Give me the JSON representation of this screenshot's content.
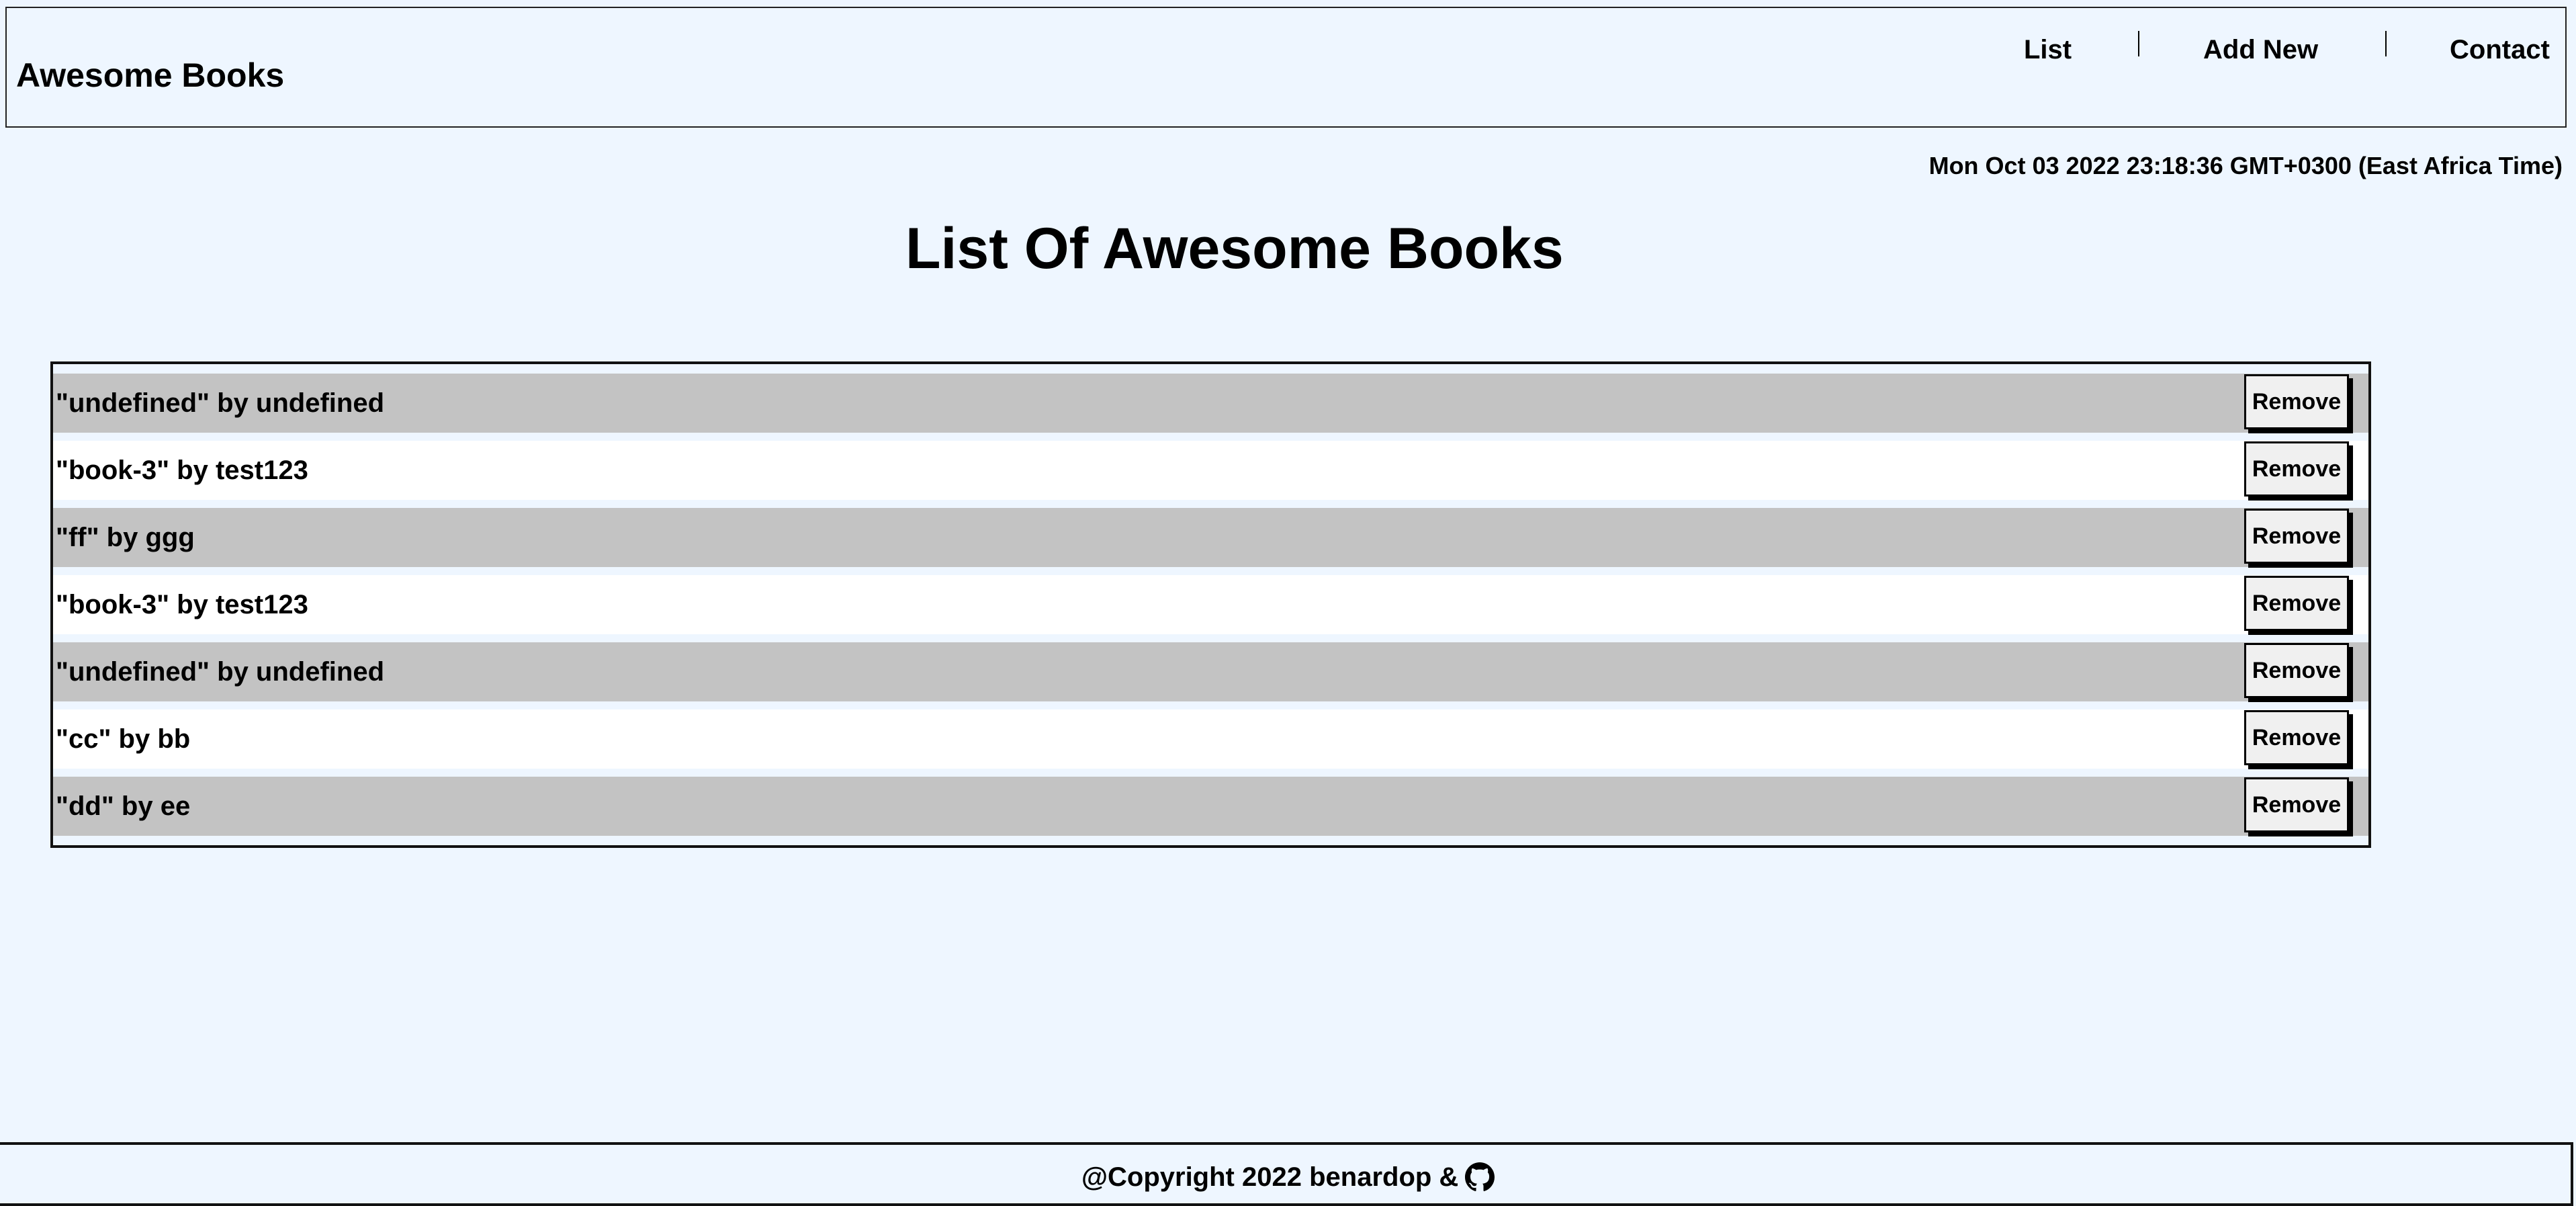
{
  "header": {
    "brand": "Awesome Books",
    "nav": {
      "list": "List",
      "add_new": "Add New",
      "contact": "Contact"
    }
  },
  "date_text": "Mon Oct 03 2022 23:18:36 GMT+0300 (East Africa Time)",
  "page_title": "List Of Awesome Books",
  "books": [
    {
      "text": "\"undefined\" by undefined",
      "remove_label": "Remove"
    },
    {
      "text": "\"book-3\" by test123",
      "remove_label": "Remove"
    },
    {
      "text": "\"ff\" by ggg",
      "remove_label": "Remove"
    },
    {
      "text": "\"book-3\" by test123",
      "remove_label": "Remove"
    },
    {
      "text": "\"undefined\" by undefined",
      "remove_label": "Remove"
    },
    {
      "text": "\"cc\" by bb",
      "remove_label": "Remove"
    },
    {
      "text": "\"dd\" by ee",
      "remove_label": "Remove"
    }
  ],
  "footer": {
    "text": "@Copyright 2022 benardop &",
    "icon": "github-icon"
  },
  "colors": {
    "page_background": "#eef6ff",
    "row_odd": "#c3c3c3",
    "row_even": "#ffffff",
    "button_background": "#f0f0f0"
  }
}
